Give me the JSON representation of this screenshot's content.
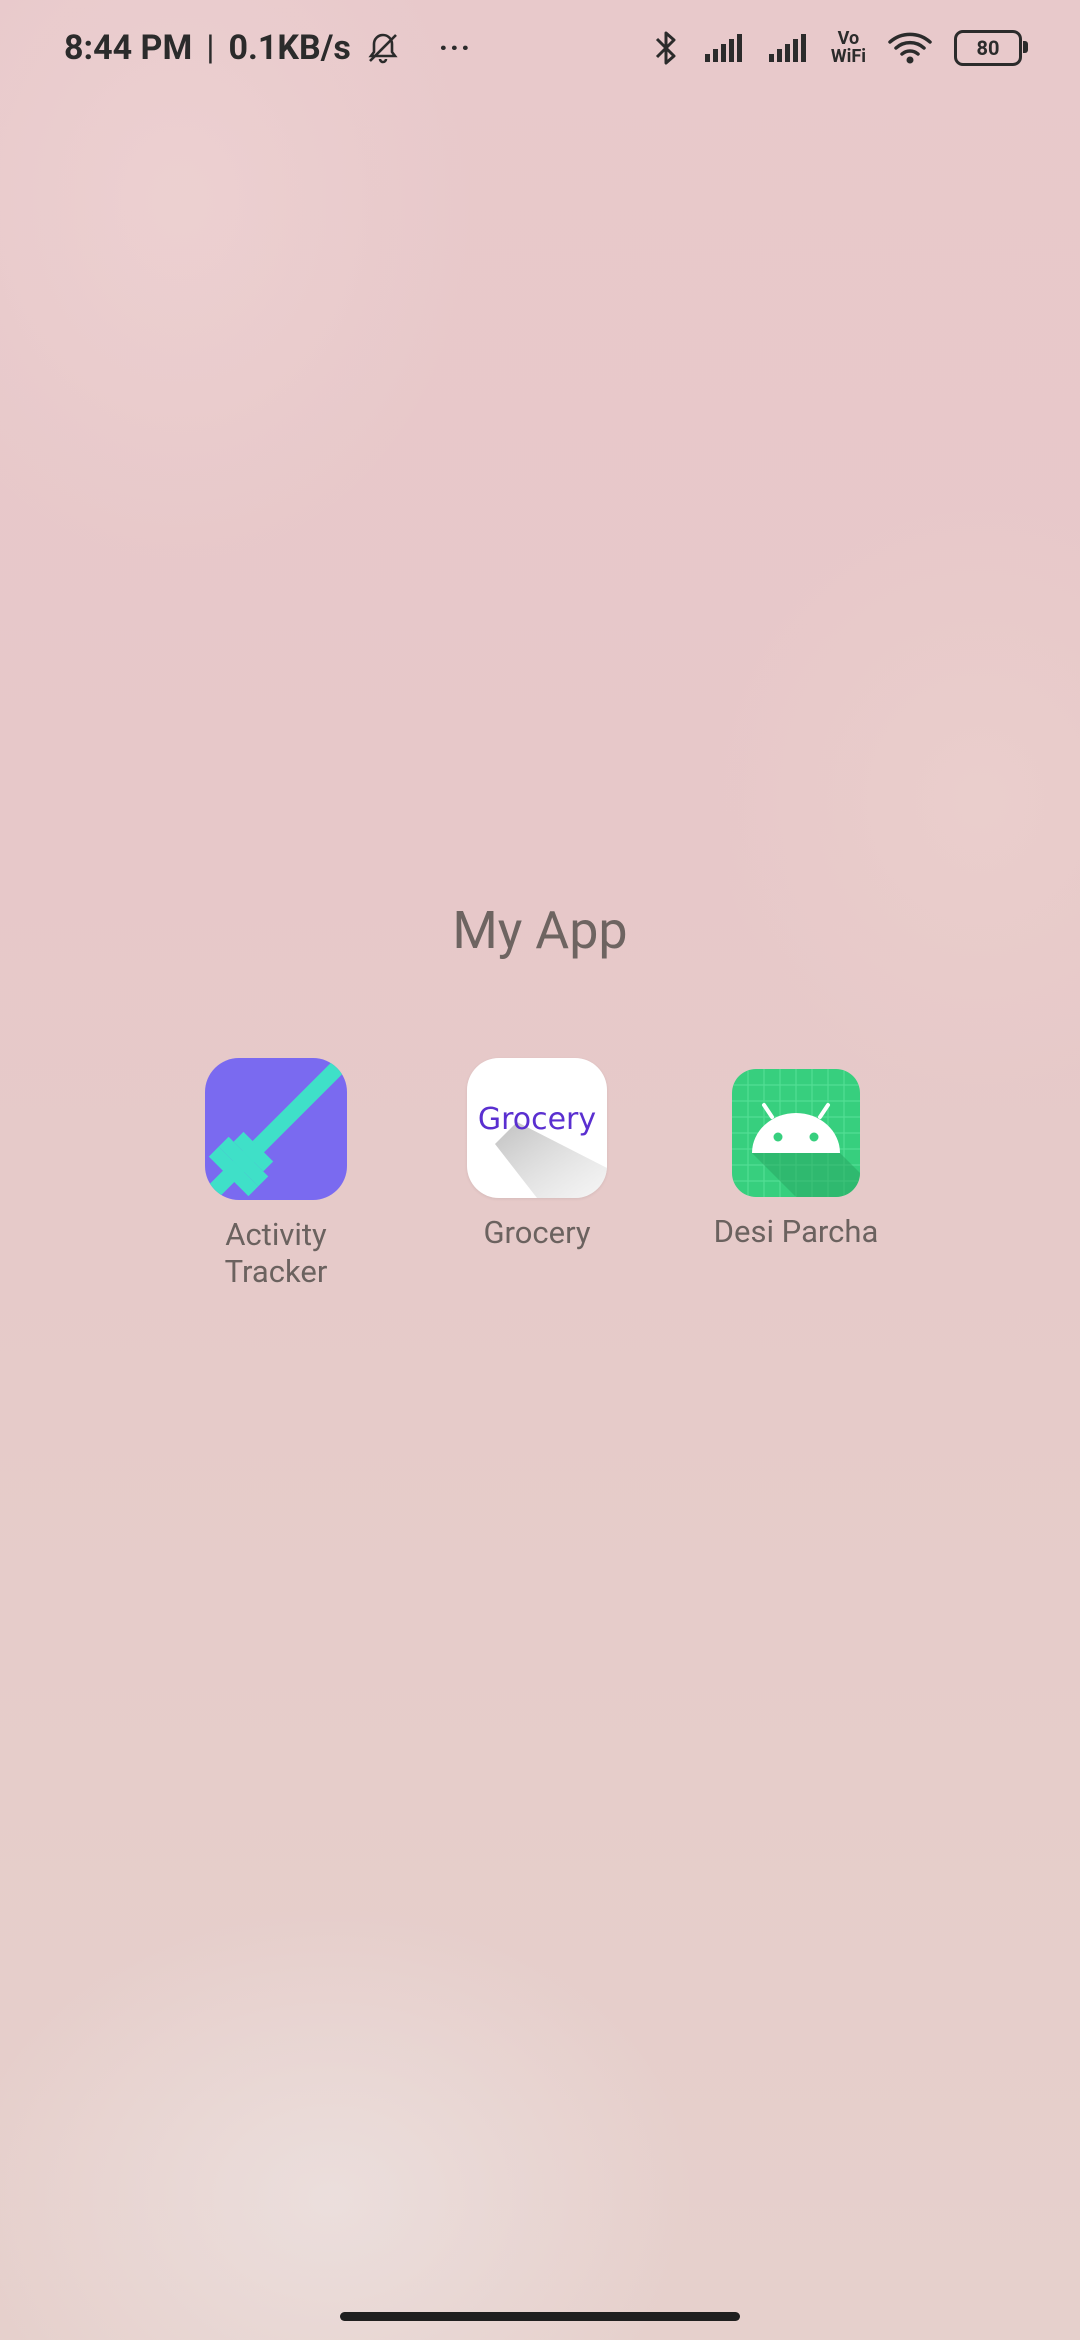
{
  "status_bar": {
    "time": "8:44 PM",
    "separator": "|",
    "net_speed": "0.1KB/s",
    "more": "···",
    "vowifi_top": "Vo",
    "vowifi_bottom": "WiFi",
    "battery": "80",
    "icons": [
      "bell-muted-icon",
      "bluetooth-icon",
      "signal-1-icon",
      "signal-2-icon",
      "vowifi-icon",
      "wifi-icon",
      "battery-icon"
    ]
  },
  "folder": {
    "title": "My App",
    "apps": [
      {
        "label": "Activity\nTracker",
        "icon": "dumbbell-icon",
        "icon_color": "#7a6af0",
        "accent_color": "#3fe0c8"
      },
      {
        "label": "Grocery",
        "icon": "grocery-text-icon",
        "icon_text": "Grocery",
        "icon_text_color": "#5a2fd0"
      },
      {
        "label": "Desi Parcha",
        "icon": "android-icon",
        "icon_color": "#37cf7e"
      }
    ]
  }
}
